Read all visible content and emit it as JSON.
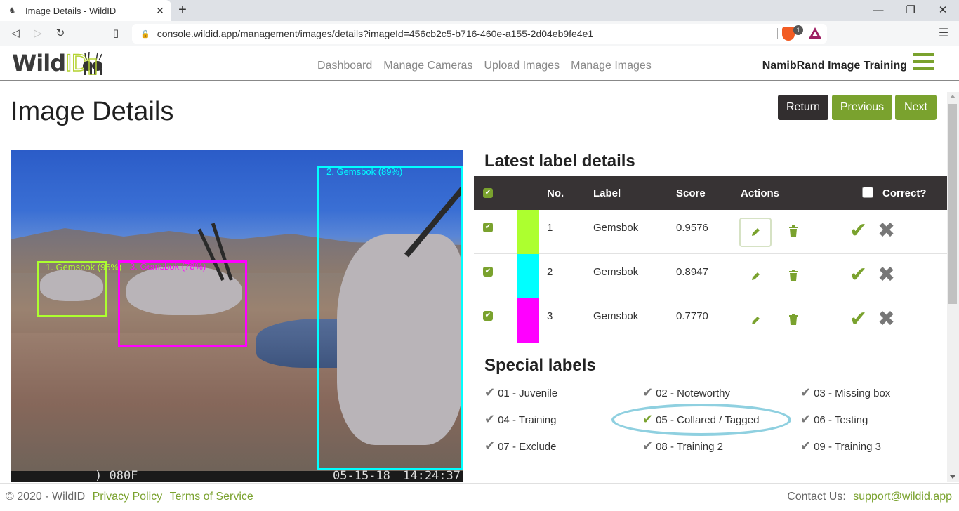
{
  "browser": {
    "tab_title": "Image Details - WildID",
    "url": "console.wildid.app/management/images/details?imageId=456cb2c5-b716-460e-a155-2d04eb9fe4e1",
    "brave_badge_count": "1"
  },
  "header": {
    "logo_wild": "Wild",
    "logo_id": "ID",
    "nav": [
      "Dashboard",
      "Manage Cameras",
      "Upload Images",
      "Manage Images"
    ],
    "org_name": "NamibRand Image Training"
  },
  "page": {
    "title": "Image Details",
    "buttons": {
      "return": "Return",
      "previous": "Previous",
      "next": "Next"
    }
  },
  "photo": {
    "overlay_left": ") 080F",
    "overlay_datetime": "05-15-18 14:24:37",
    "boxes": [
      {
        "label": "1. Gemsbok (96%)",
        "color": "#adff2f"
      },
      {
        "label": "2. Gemsbok (89%)",
        "color": "#00ffff"
      },
      {
        "label": "3. Gemsbok (78%)",
        "color": "#ff00ff"
      }
    ]
  },
  "labels": {
    "title": "Latest label details",
    "columns": {
      "no": "No.",
      "label": "Label",
      "score": "Score",
      "actions": "Actions",
      "correct": "Correct?"
    },
    "rows": [
      {
        "no": "1",
        "label": "Gemsbok",
        "score": "0.9576",
        "color": "#adff2f"
      },
      {
        "no": "2",
        "label": "Gemsbok",
        "score": "0.8947",
        "color": "#00ffff"
      },
      {
        "no": "3",
        "label": "Gemsbok",
        "score": "0.7770",
        "color": "#ff00ff"
      }
    ]
  },
  "special": {
    "title": "Special labels",
    "items": [
      {
        "label": "01 - Juvenile",
        "active": false
      },
      {
        "label": "02 - Noteworthy",
        "active": false
      },
      {
        "label": "03 - Missing box",
        "active": false
      },
      {
        "label": "04 - Training",
        "active": false
      },
      {
        "label": "05 - Collared / Tagged",
        "active": true
      },
      {
        "label": "06 - Testing",
        "active": false
      },
      {
        "label": "07 - Exclude",
        "active": false
      },
      {
        "label": "08 - Training 2",
        "active": false
      },
      {
        "label": "09 - Training 3",
        "active": false
      }
    ]
  },
  "footer": {
    "copyright": "© 2020 - WildID",
    "privacy": "Privacy Policy",
    "terms": "Terms of Service",
    "contact_label": "Contact Us:",
    "contact_email": "support@wildid.app"
  },
  "colors": {
    "accent": "#7aa22e",
    "dark": "#373334"
  }
}
